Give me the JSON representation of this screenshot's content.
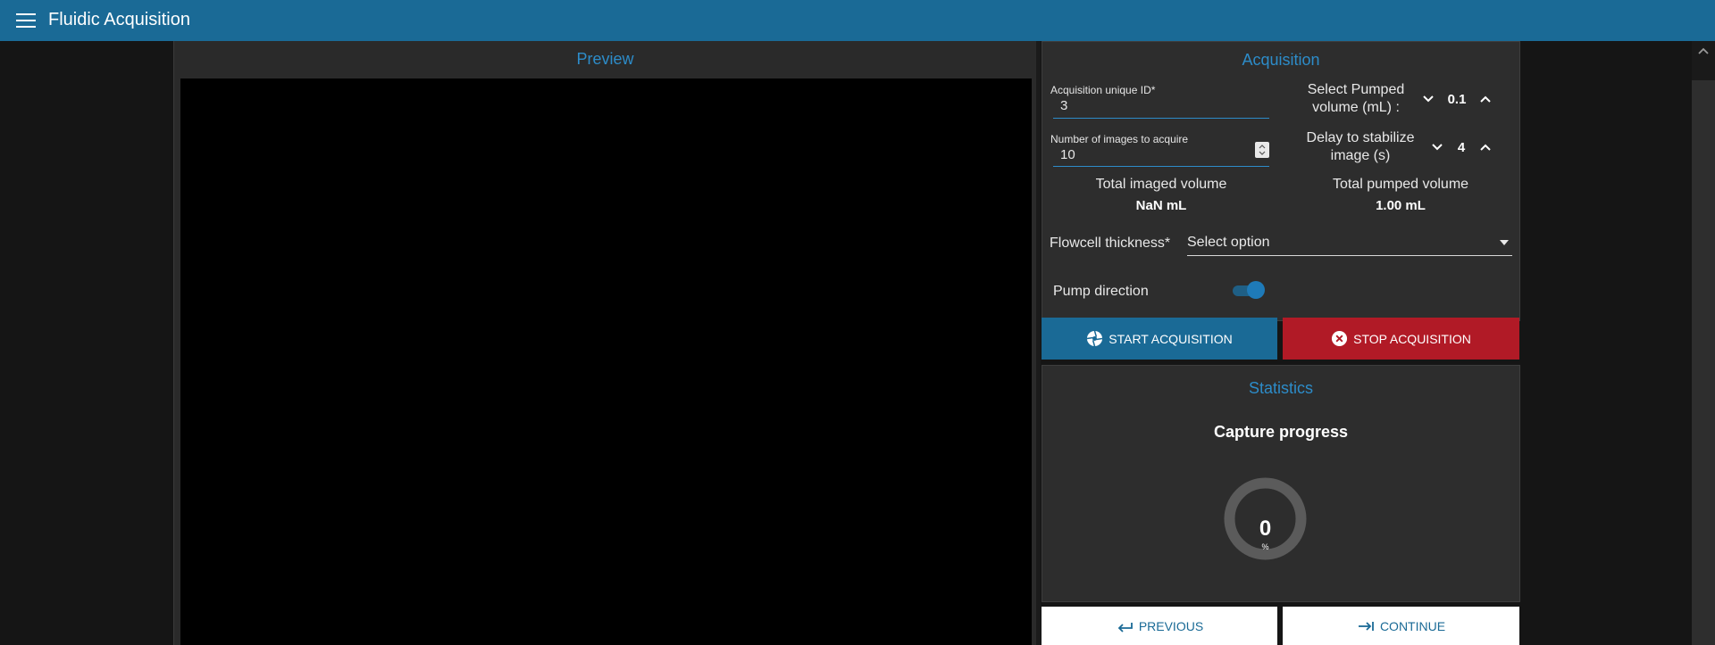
{
  "header": {
    "title": "Fluidic Acquisition",
    "menu_icon": "hamburger-menu-icon"
  },
  "preview": {
    "title": "Preview"
  },
  "acquisition": {
    "title": "Acquisition",
    "unique_id": {
      "label": "Acquisition unique ID*",
      "value": "3"
    },
    "num_images": {
      "label": "Number of images to acquire",
      "value": "10"
    },
    "pumped_volume": {
      "label_line1": "Select Pumped",
      "label_line2": "volume (mL) :",
      "value": "0.1"
    },
    "delay": {
      "label_line1": "Delay to stabilize",
      "label_line2": "image (s)",
      "value": "4"
    },
    "total_imaged": {
      "label": "Total imaged volume",
      "value": "NaN mL"
    },
    "total_pumped": {
      "label": "Total pumped volume",
      "value": "1.00 mL"
    },
    "flowcell": {
      "label": "Flowcell thickness*",
      "placeholder": "Select option"
    },
    "pump_direction": {
      "label": "Pump direction",
      "enabled": true
    },
    "start_label": "START ACQUISITION",
    "stop_label": "STOP ACQUISITION"
  },
  "statistics": {
    "title": "Statistics",
    "capture_title": "Capture progress",
    "progress_value": "0",
    "progress_unit": "%"
  },
  "nav": {
    "previous_label": "PREVIOUS",
    "continue_label": "CONTINUE"
  },
  "colors": {
    "accent": "#1a6a96",
    "title_blue": "#2d8cc9",
    "stop_red": "#b11a26",
    "panel_bg": "#2d2d2d"
  }
}
